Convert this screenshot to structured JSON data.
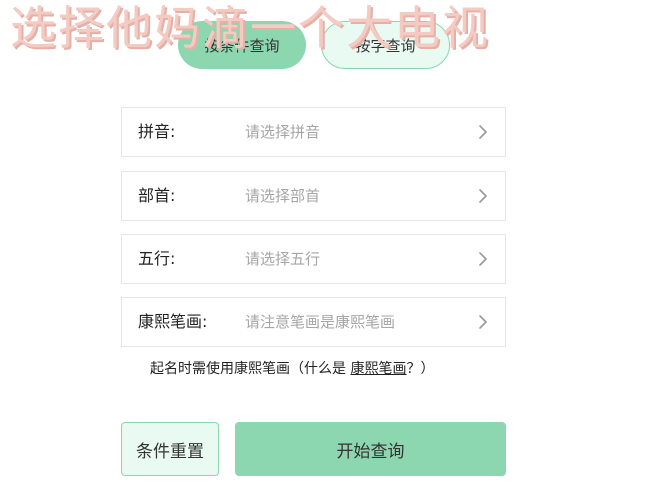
{
  "watermark": "选择他妈滴一个大电视",
  "tabs": [
    {
      "label": "按条件查询",
      "active": true
    },
    {
      "label": "按字查询",
      "active": false
    }
  ],
  "fields": [
    {
      "label": "拼音:",
      "placeholder": "请选择拼音"
    },
    {
      "label": "部首:",
      "placeholder": "请选择部首"
    },
    {
      "label": "五行:",
      "placeholder": "请选择五行"
    },
    {
      "label": "康熙笔画:",
      "placeholder": "请注意笔画是康熙笔画"
    }
  ],
  "note": {
    "prefix": "起名时需使用康熙笔画（什么是 ",
    "link": "康熙笔画",
    "suffix": "？）"
  },
  "buttons": {
    "reset": "条件重置",
    "search": "开始查询"
  },
  "colors": {
    "accent": "#8cd6b0",
    "accent_light": "#e8faf1",
    "placeholder": "#a6a6a6",
    "watermark": "#f3cbc3"
  },
  "icons": {
    "row_arrow": "chevron-right-icon"
  }
}
